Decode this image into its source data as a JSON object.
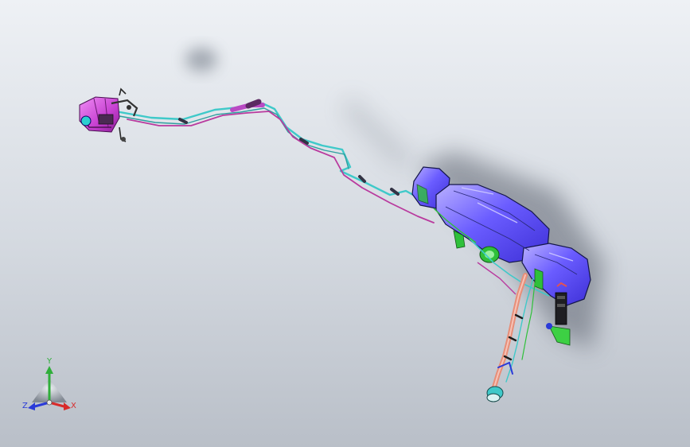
{
  "triad": {
    "x_label": "X",
    "y_label": "Y",
    "z_label": "Z",
    "x_color": "#d82a2a",
    "y_color": "#2fae3a",
    "z_color": "#2a3ad8"
  },
  "model_colors": {
    "canister": "#c63fd1",
    "tank": "#6a5cff",
    "tank_outline": "#14164a",
    "lines_cyan": "#3fc9c9",
    "lines_magenta": "#b93a9e",
    "brackets_green": "#2fc03a",
    "filler_neck": "#e78e78"
  }
}
